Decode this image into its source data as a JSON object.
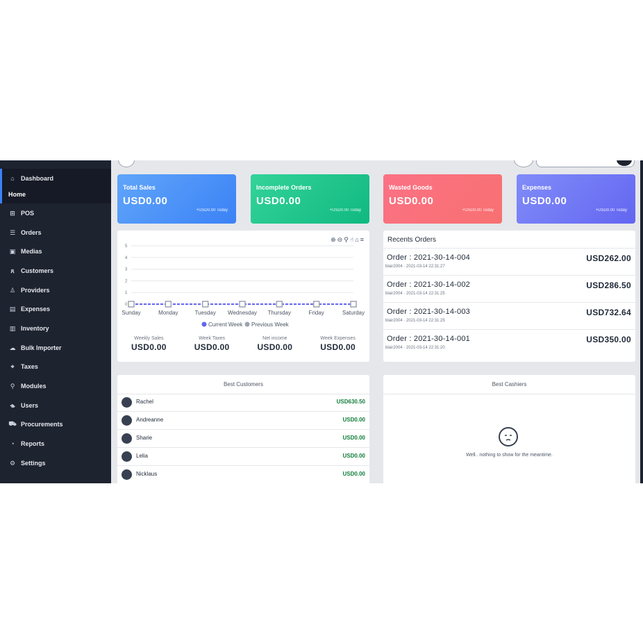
{
  "sidebar": {
    "dashboard": "Dashboard",
    "home": "Home",
    "items": [
      {
        "label": "POS",
        "icon": "cart-icon"
      },
      {
        "label": "Orders",
        "icon": "list-icon"
      },
      {
        "label": "Medias",
        "icon": "image-icon"
      },
      {
        "label": "Customers",
        "icon": "users-icon"
      },
      {
        "label": "Providers",
        "icon": "user-icon"
      },
      {
        "label": "Expenses",
        "icon": "money-icon"
      },
      {
        "label": "Inventory",
        "icon": "box-icon"
      },
      {
        "label": "Bulk Importer",
        "icon": "cloud-upload-icon"
      },
      {
        "label": "Taxes",
        "icon": "tag-icon"
      },
      {
        "label": "Modules",
        "icon": "plug-icon"
      },
      {
        "label": "Users",
        "icon": "user-group-icon"
      },
      {
        "label": "Procurements",
        "icon": "truck-icon"
      },
      {
        "label": "Reports",
        "icon": "chart-icon"
      },
      {
        "label": "Settings",
        "icon": "gear-icon"
      }
    ]
  },
  "cards": [
    {
      "label": "Total Sales",
      "value": "USD0.00",
      "sub": "+USD0.00 Today"
    },
    {
      "label": "Incomplete Orders",
      "value": "USD0.00",
      "sub": "+USD0.00 Today"
    },
    {
      "label": "Wasted Goods",
      "value": "USD0.00",
      "sub": "+USD0.00 Today"
    },
    {
      "label": "Expenses",
      "value": "USD0.00",
      "sub": "+USD0.00 Today"
    }
  ],
  "chart_data": {
    "type": "line",
    "categories": [
      "Sunday",
      "Monday",
      "Tuesday",
      "Wednesday",
      "Thursday",
      "Friday",
      "Saturday"
    ],
    "series": [
      {
        "name": "Current Week",
        "values": [
          0,
          0,
          0,
          0,
          0,
          0,
          0
        ],
        "color": "#6366f1"
      },
      {
        "name": "Previous Week",
        "values": [
          0,
          0,
          0,
          0,
          0,
          0,
          0
        ],
        "color": "#9ca3af"
      }
    ],
    "yticks": [
      "5",
      "4",
      "3",
      "2",
      "1",
      "0"
    ],
    "ylim": [
      0,
      5
    ],
    "legend_position": "bottom",
    "grid": true
  },
  "chart_stats": [
    {
      "title": "Weekly Sales",
      "value": "USD0.00"
    },
    {
      "title": "Week Taxes",
      "value": "USD0.00"
    },
    {
      "title": "Net income",
      "value": "USD0.00"
    },
    {
      "title": "Week Expenses",
      "value": "USD0.00"
    }
  ],
  "recent_orders": {
    "title": "Recents Orders",
    "rows": [
      {
        "order": "Order : 2021-30-14-004",
        "meta": "blair2004 · 2021-03-14 22:31:27",
        "amount": "USD262.00"
      },
      {
        "order": "Order : 2021-30-14-002",
        "meta": "blair2004 · 2021-03-14 22:31:25",
        "amount": "USD286.50"
      },
      {
        "order": "Order : 2021-30-14-003",
        "meta": "blair2004 · 2021-03-14 22:31:25",
        "amount": "USD732.64"
      },
      {
        "order": "Order : 2021-30-14-001",
        "meta": "blair2004 · 2021-03-14 22:31:20",
        "amount": "USD350.00"
      }
    ]
  },
  "best_customers": {
    "title": "Best Customers",
    "rows": [
      {
        "name": "Rachel",
        "amount": "USD630.50"
      },
      {
        "name": "Andreanne",
        "amount": "USD0.00"
      },
      {
        "name": "Sharie",
        "amount": "USD0.00"
      },
      {
        "name": "Lelia",
        "amount": "USD0.00"
      },
      {
        "name": "Nicklaus",
        "amount": "USD0.00"
      }
    ]
  },
  "best_cashiers": {
    "title": "Best Cashiers",
    "empty_message": "Well.. nothing to show for the meantime."
  }
}
